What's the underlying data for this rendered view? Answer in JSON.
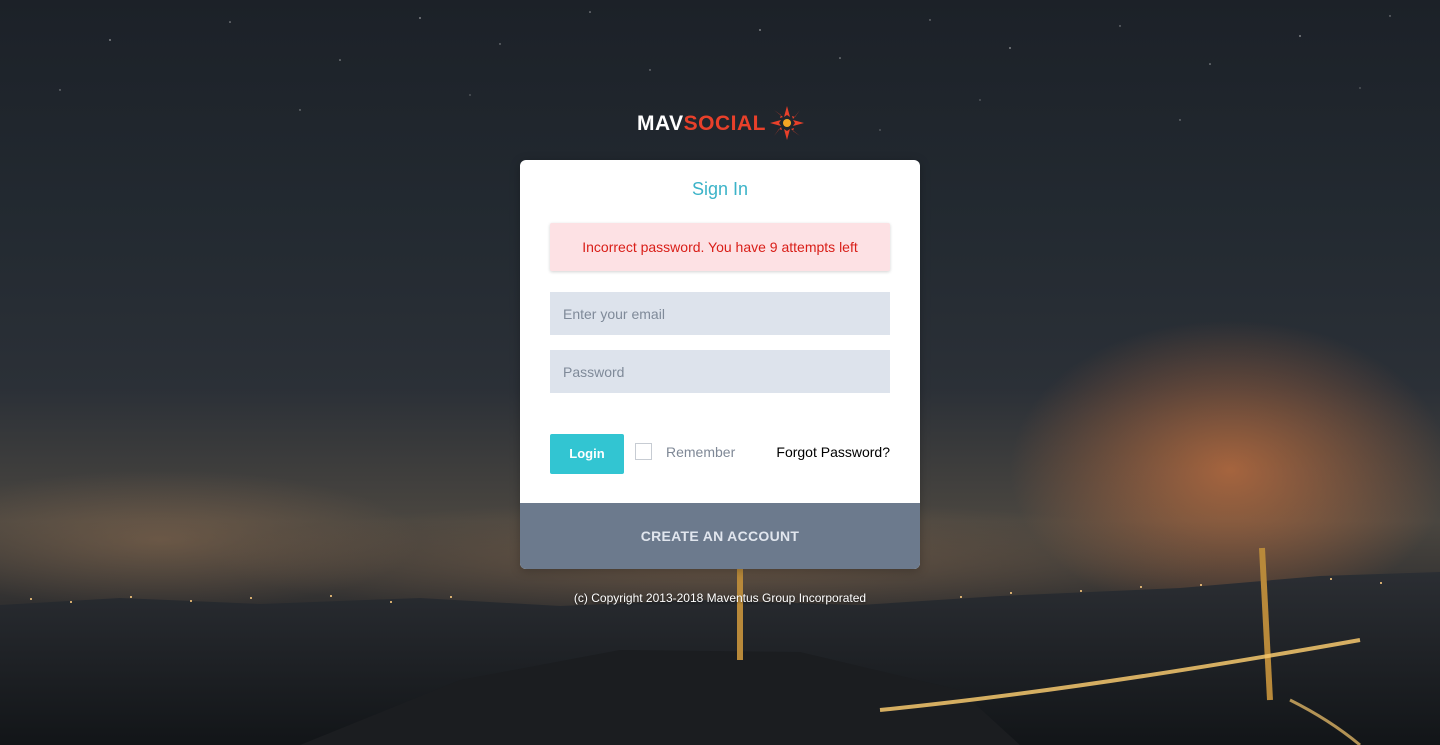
{
  "brand": {
    "name_part1": "MAV",
    "name_part2": "SOCIAL",
    "logo_icon": "starburst-logo-icon",
    "accent_color": "#e8402a"
  },
  "signin": {
    "title": "Sign In",
    "alert": "Incorrect password. You have 9 attempts left",
    "email_placeholder": "Enter your email",
    "password_placeholder": "Password",
    "login_label": "Login",
    "remember_label": "Remember",
    "remember_checked": false,
    "forgot_label": "Forgot Password?",
    "create_account_label": "CREATE AN ACCOUNT"
  },
  "footer": {
    "copyright": "(c) Copyright 2013-2018 Maventus Group Incorporated"
  },
  "colors": {
    "title": "#3bb3c8",
    "login_button": "#32c5d2",
    "alert_bg": "#fde1e4",
    "alert_text": "#d91e18",
    "create_bg": "#6c7a8d",
    "input_bg": "#dde3ec"
  }
}
